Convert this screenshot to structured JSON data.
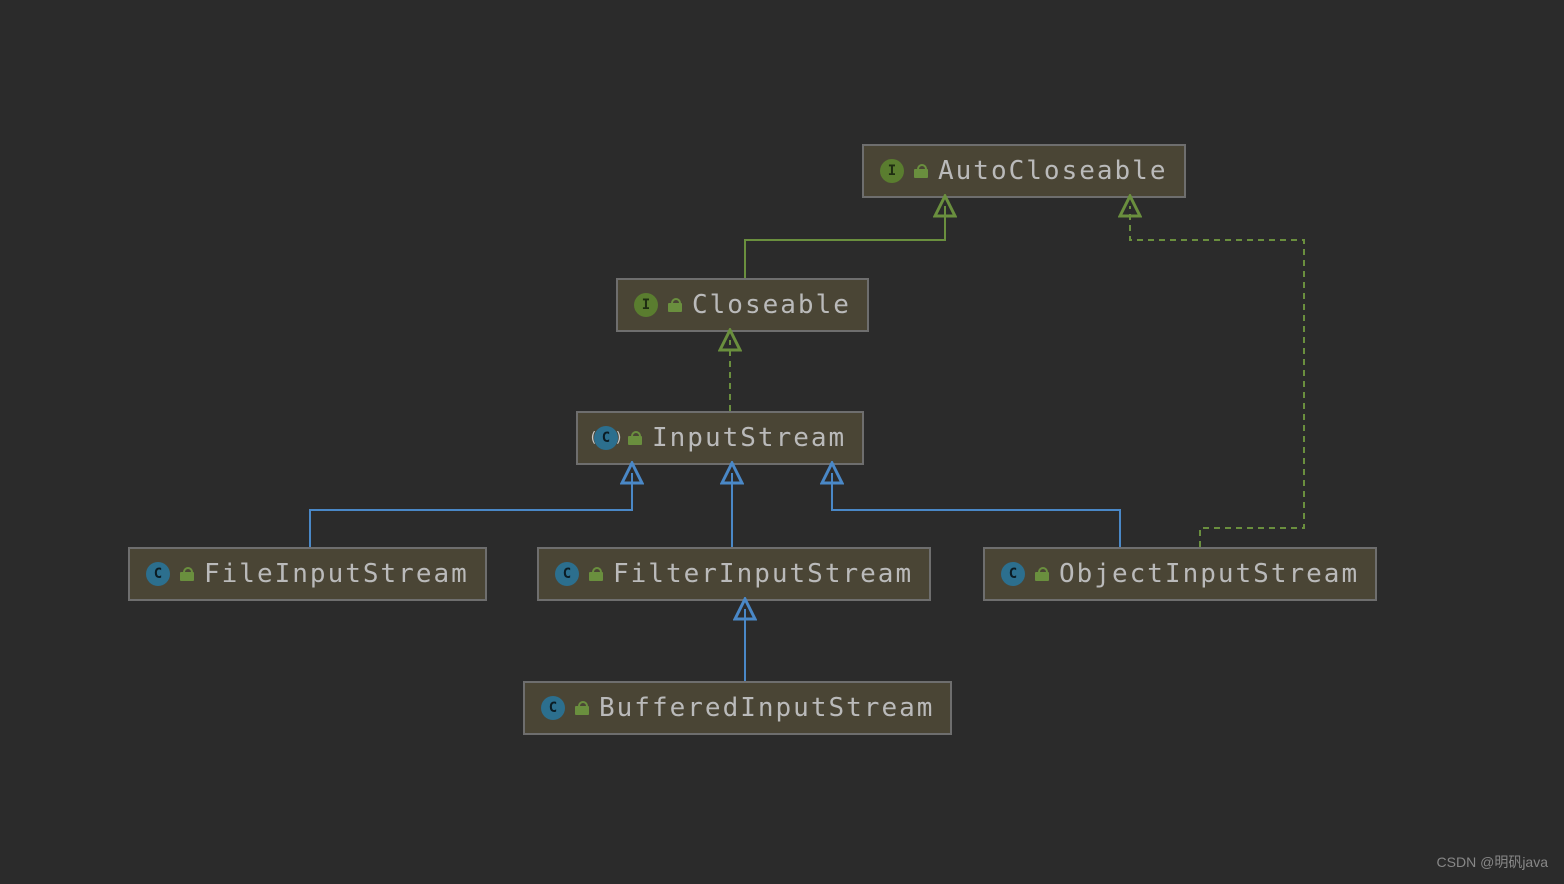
{
  "diagram": {
    "nodes": {
      "autocloseable": {
        "name": "AutoCloseable",
        "kind": "interface"
      },
      "closeable": {
        "name": "Closeable",
        "kind": "interface"
      },
      "inputstream": {
        "name": "InputStream",
        "kind": "abstract-class"
      },
      "fileis": {
        "name": "FileInputStream",
        "kind": "class"
      },
      "filteris": {
        "name": "FilterInputStream",
        "kind": "class"
      },
      "objectis": {
        "name": "ObjectInputStream",
        "kind": "class"
      },
      "bufferedis": {
        "name": "BufferedInputStream",
        "kind": "class"
      }
    },
    "edges": [
      {
        "from": "closeable",
        "to": "autocloseable",
        "rel": "extends-interface"
      },
      {
        "from": "inputstream",
        "to": "closeable",
        "rel": "implements"
      },
      {
        "from": "fileis",
        "to": "inputstream",
        "rel": "extends"
      },
      {
        "from": "filteris",
        "to": "inputstream",
        "rel": "extends"
      },
      {
        "from": "objectis",
        "to": "inputstream",
        "rel": "extends"
      },
      {
        "from": "objectis",
        "to": "autocloseable",
        "rel": "implements"
      },
      {
        "from": "bufferedis",
        "to": "filteris",
        "rel": "extends"
      }
    ],
    "colors": {
      "background": "#2b2b2b",
      "node_bg": "#4a4535",
      "node_border": "#6e6e6e",
      "text": "#bababa",
      "extends_arrow": "#4a88c7",
      "implements_arrow": "#6a8f3e"
    }
  },
  "watermark": "CSDN @明矾java"
}
